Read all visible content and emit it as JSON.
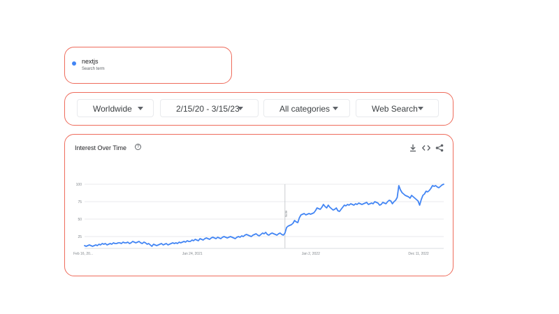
{
  "search_term": {
    "name": "nextjs",
    "subtitle": "Search term",
    "color": "#4285f4"
  },
  "filters": [
    {
      "label": "Worldwide"
    },
    {
      "label": "2/15/20 - 3/15/23"
    },
    {
      "label": "All categories"
    },
    {
      "label": "Web Search"
    }
  ],
  "chart_card": {
    "title": "Interest Over Time",
    "help_icon": "help-circle-icon",
    "tools": [
      "download-icon",
      "embed-code-icon",
      "share-icon"
    ]
  },
  "chart_data": {
    "type": "line",
    "y_ticks": [
      "100",
      "75",
      "50",
      "25"
    ],
    "ylim": [
      0,
      100
    ],
    "x_tick_labels": [
      "Feb 16, 20...",
      "Jan 24, 2021",
      "Jan 2, 2022",
      "Dec 11, 2022"
    ],
    "annotation": "Note",
    "grid": true,
    "series": [
      {
        "color": "#4285f4",
        "values": [
          12,
          11,
          12,
          13,
          12,
          11,
          12,
          13,
          12,
          14,
          13,
          15,
          14,
          15,
          13,
          14,
          15,
          14,
          16,
          15,
          15,
          16,
          16,
          15,
          17,
          16,
          16,
          17,
          15,
          16,
          18,
          17,
          16,
          17,
          18,
          16,
          15,
          17,
          16,
          14,
          15,
          13,
          11,
          14,
          13,
          12,
          13,
          14,
          15,
          13,
          14,
          15,
          13,
          14,
          15,
          16,
          15,
          16,
          15,
          17,
          16,
          17,
          18,
          17,
          19,
          18,
          18,
          20,
          19,
          21,
          20,
          19,
          22,
          21,
          20,
          22,
          23,
          22,
          21,
          23,
          24,
          23,
          22,
          24,
          23,
          22,
          24,
          25,
          24,
          23,
          24,
          25,
          24,
          23,
          22,
          24,
          25,
          24,
          26,
          25,
          27,
          28,
          27,
          26,
          25,
          27,
          28,
          29,
          27,
          26,
          28,
          30,
          29,
          31,
          28,
          27,
          29,
          30,
          29,
          28,
          27,
          29,
          30,
          28,
          27,
          30,
          38,
          40,
          41,
          42,
          44,
          48,
          46,
          45,
          52,
          56,
          57,
          58,
          56,
          57,
          58,
          57,
          58,
          59,
          62,
          66,
          65,
          64,
          67,
          71,
          68,
          66,
          70,
          67,
          65,
          63,
          64,
          66,
          62,
          61,
          64,
          67,
          70,
          69,
          71,
          70,
          72,
          71,
          70,
          72,
          71,
          73,
          72,
          71,
          72,
          73,
          74,
          71,
          72,
          73,
          72,
          75,
          74,
          73,
          70,
          71,
          74,
          73,
          72,
          75,
          77,
          76,
          72,
          75,
          77,
          81,
          98,
          92,
          88,
          86,
          84,
          83,
          82,
          80,
          84,
          82,
          80,
          78,
          76,
          70,
          78,
          84,
          86,
          90,
          89,
          91,
          94,
          98,
          97,
          98,
          96,
          95,
          97,
          99,
          100
        ]
      }
    ]
  }
}
